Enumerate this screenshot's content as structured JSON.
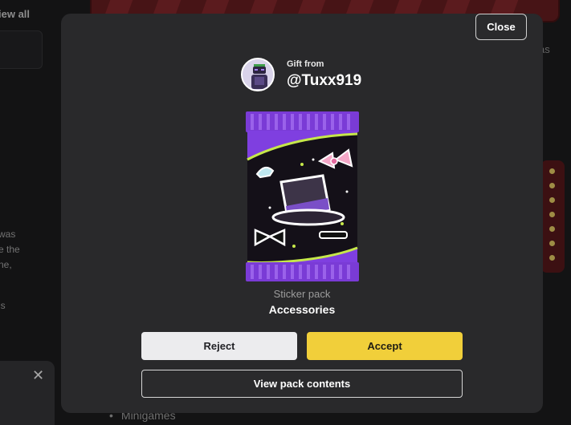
{
  "background": {
    "view_all_label": "iew all",
    "side_lines": [
      "was",
      "e the",
      "ne,",
      "is"
    ],
    "right_fragment": "as",
    "minigames_label": "Minigames",
    "toast_close_glyph": "✕"
  },
  "modal": {
    "close_label": "Close",
    "gift_from_label": "Gift from",
    "sender_username": "@Tuxx919",
    "pack_type": "Sticker pack",
    "pack_name": "Accessories",
    "reject_label": "Reject",
    "accept_label": "Accept",
    "view_contents_label": "View pack contents"
  },
  "colors": {
    "modal_bg": "#29292b",
    "accept": "#f1cf3a",
    "reject": "#ececee",
    "pack_purple": "#7a3bd6",
    "pack_accent": "#c6e84a"
  },
  "icons": {
    "close_toast": "close-icon",
    "pack_stickers": [
      "top-hat-icon",
      "pink-bow-icon",
      "tiara-icon",
      "bow-tie-icon",
      "sunglasses-icon"
    ]
  }
}
